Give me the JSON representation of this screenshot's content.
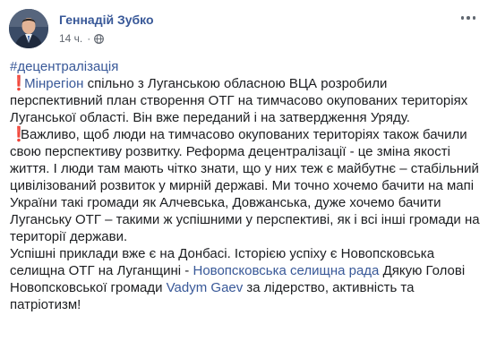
{
  "author": {
    "name": "Геннадій Зубко"
  },
  "meta": {
    "time": "14 ч.",
    "separator": "·",
    "audience_icon": "globe-icon"
  },
  "menu_icon": "more-horizontal-icon",
  "post": {
    "hashtag": "#децентралізація",
    "p1_emoji": "❗",
    "p1_link": "Мінрегіон",
    "p1_text": " спільно з Луганською обласною ВЦА розробили перспективний план створення ОТГ на тимчасово окупованих територіях Луганської області. Він вже переданий і на затвердження Уряду.",
    "p2_emoji": "❗",
    "p2_text": "Важливо, щоб люди на тимчасово окупованих територіях також бачили свою перспективу розвитку. Реформа децентралізації - це зміна якості життя. І люди там мають чітко знати, що у них теж є майбутнє – стабільний цивілізований розвиток у мирній державі. Ми точно хочемо бачити на мапі України такі громади як Алчевська, Довжанська, дуже хочемо бачити Луганську ОТГ – такими ж успішними у перспективі, як і всі інші громади на території держави.",
    "p3_text1": "Успішні приклади вже є на Донбасі. Історією успіху є Новопсковська селищна ОТГ на Луганщині - ",
    "p3_link1": "Новопсковська селищна рада",
    "p3_text2": " Дякую Голові Новопсковської громади ",
    "p3_link2": "Vadym Gaev",
    "p3_text3": " за лідерство, активність та патріотизм!"
  },
  "colors": {
    "link": "#385898",
    "text": "#1c1e21",
    "meta": "#616770",
    "emoji": "#dd2e44"
  }
}
